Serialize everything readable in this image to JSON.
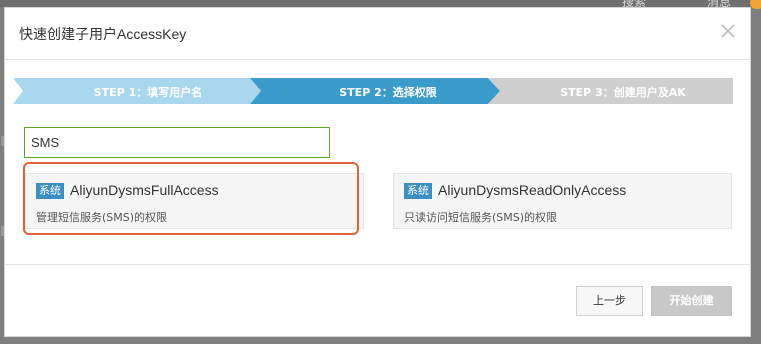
{
  "background": {
    "search_label": "搜索",
    "message_label": "消息"
  },
  "dialog": {
    "title": "快速创建子用户AccessKey",
    "close_icon": "close-icon"
  },
  "steps": [
    {
      "label": "STEP 1：填写用户名",
      "state": "done",
      "color": "#a9d8ee"
    },
    {
      "label": "STEP 2：选择权限",
      "state": "active",
      "color": "#3b9ccb"
    },
    {
      "label": "STEP 3：创建用户及AK",
      "state": "pending",
      "color": "#cfcfcf"
    }
  ],
  "search": {
    "value": "SMS"
  },
  "policies": [
    {
      "tag": "系统",
      "name": "AliyunDysmsFullAccess",
      "description": "管理短信服务(SMS)的权限",
      "highlighted": true
    },
    {
      "tag": "系统",
      "name": "AliyunDysmsReadOnlyAccess",
      "description": "只读访问短信服务(SMS)的权限",
      "highlighted": false
    }
  ],
  "buttons": {
    "prev_label": "上一步",
    "start_label": "开始创建"
  },
  "colors": {
    "accent": "#3b9ccb",
    "highlight_border": "#e3623a",
    "search_border": "#5ba829",
    "tag_bg": "#3b8ec4"
  }
}
